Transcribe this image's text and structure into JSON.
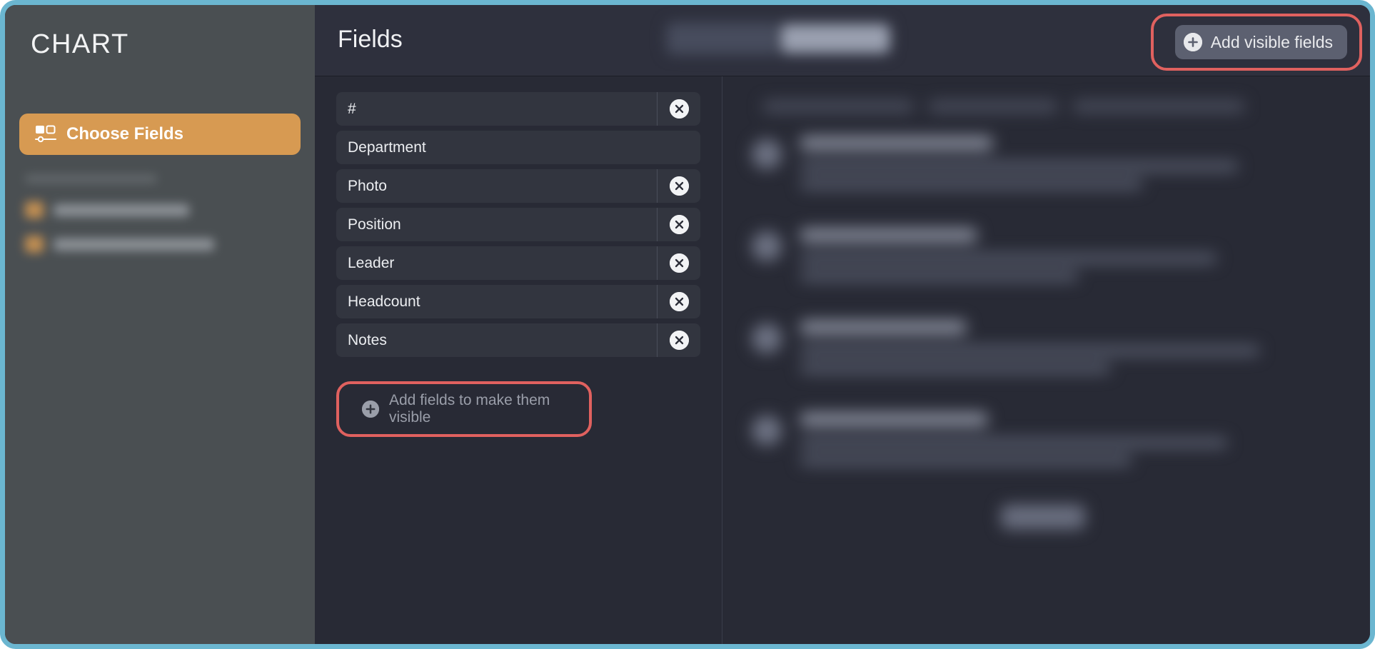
{
  "window": {
    "frame_accent_color": "#6bb6d0",
    "highlight_color": "#e0615f",
    "accent_orange": "#d79a52"
  },
  "sidebar": {
    "title": "CHART",
    "choose_fields": {
      "label": "Choose Fields",
      "icon": "fields-layout-icon",
      "selected": true
    },
    "blurred_section": {
      "visible": true,
      "item_count": 2
    }
  },
  "header": {
    "title": "Fields",
    "segmented_control": {
      "visible": true,
      "segment_count": 2,
      "selected_index": 1
    },
    "add_visible_fields": {
      "label": "Add visible fields",
      "icon": "plus-circle-icon",
      "highlighted": true
    }
  },
  "fields_panel": {
    "rows": [
      {
        "name": "#",
        "removable": true
      },
      {
        "name": "Department",
        "removable": false
      },
      {
        "name": "Photo",
        "removable": true
      },
      {
        "name": "Position",
        "removable": true
      },
      {
        "name": "Leader",
        "removable": true
      },
      {
        "name": "Headcount",
        "removable": true
      },
      {
        "name": "Notes",
        "removable": true
      }
    ],
    "remove_icon": "close-circle-icon",
    "add_fields_button": {
      "label": "Add fields to make them visible",
      "icon": "plus-circle-icon",
      "highlighted": true
    }
  },
  "preview_panel": {
    "blurred": true,
    "toolbar_chips": [
      210,
      180,
      240
    ],
    "items": [
      {
        "title_width": "36%",
        "lines": [
          "82%",
          "64%"
        ]
      },
      {
        "title_width": "33%",
        "lines": [
          "78%",
          "52%"
        ]
      },
      {
        "title_width": "31%",
        "lines": [
          "86%",
          "58%"
        ]
      },
      {
        "title_width": "35%",
        "lines": [
          "80%",
          "62%"
        ]
      }
    ],
    "footer_pill": true
  }
}
